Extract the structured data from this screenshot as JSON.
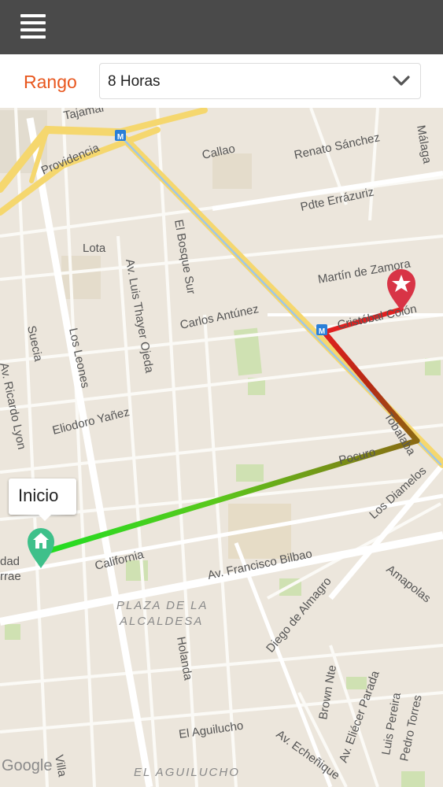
{
  "toolbar": {
    "menu_icon": "hamburger-menu-icon"
  },
  "range": {
    "label": "Rango",
    "selected": "8 Horas",
    "chevron_icon": "chevron-down-icon"
  },
  "map": {
    "streets": {
      "tajamar": "Tajamar",
      "providencia": "Providencia",
      "callao": "Callao",
      "renato_sanchez": "Renato Sánchez",
      "malaga": "Málaga",
      "pdte_errazuriz": "Pdte Errázuriz",
      "lota": "Lota",
      "el_bosque_sur": "El Bosque Sur",
      "martin_de_zamora": "Martín de Zamora",
      "av_luis_thayer_ojeda": "Av. Luis Thayer Ojeda",
      "carlos_antunez": "Carlos Antúnez",
      "cristobal_colon": "Cristóbal Colón",
      "suecia": "Suecia",
      "los_leones": "Los Leones",
      "av_ricardo_lyon": "Av. Ricardo Lyon",
      "eliodoro_yanez": "Eliodoro Yañez",
      "tobalaba": "Tobalaba",
      "pocuro": "Pocuro",
      "los_diamelos": "Los Diamelos",
      "california": "California",
      "av_francisco_bilbao": "Av. Francisco Bilbao",
      "amapolas": "Amapolas",
      "diego_de_almagro": "Diego de Almagro",
      "holanda": "Holanda",
      "brown_nte": "Brown Nte",
      "av_eliecer_parada": "Av. Eliécer Parada",
      "luis_pereira": "Luis Pereira",
      "pedro_torres": "Pedro Torres",
      "el_aguilucho": "El Aguilucho",
      "av_echenique": "Av. Echeñique",
      "dad_partial": "dad",
      "rrae_partial": "rrae",
      "villa_partial": "Villa"
    },
    "districts": {
      "plaza_line1": "PLAZA DE LA",
      "plaza_line2": "ALCALDESA",
      "el_aguilucho": "EL AGUILUCHO"
    },
    "start_label": "Inicio",
    "start_icon": "home-marker-icon",
    "end_icon": "star-marker-icon",
    "metro_icon": "metro-icon",
    "attribution": "Google",
    "route_colors": {
      "start": "#22dd22",
      "mid": "#8a6a12",
      "end": "#e02020"
    }
  }
}
